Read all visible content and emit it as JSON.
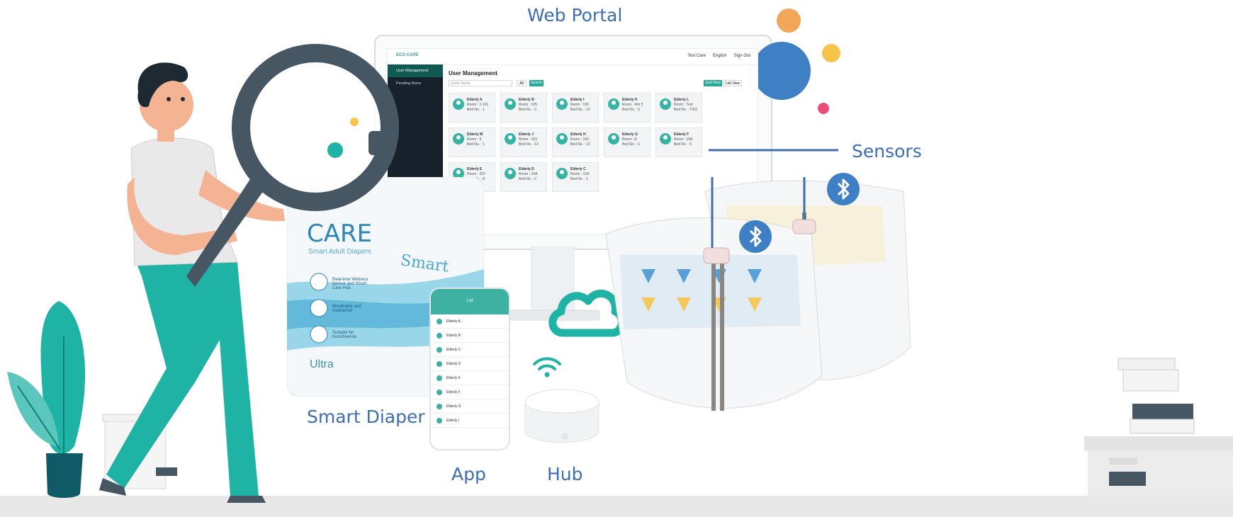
{
  "labels": {
    "web_portal": "Web Portal",
    "sensors": "Sensors",
    "smart_diaper": "Smart Diaper",
    "app": "App",
    "hub": "Hub"
  },
  "portal": {
    "brand": "ECO CARE",
    "top_user": "Test Care",
    "top_lang": "English",
    "top_signout": "Sign Out",
    "sidebar": [
      "User Management",
      "Pending Items"
    ],
    "title": "User Management",
    "search_placeholder": "Enter Name",
    "all_label": "All",
    "search_label": "Search",
    "grid_label": "Grid View",
    "list_label": "List View",
    "cards": [
      {
        "name": "Elderly A",
        "room": "Room : 1-101",
        "bed": "Bed No. : 1"
      },
      {
        "name": "Elderly B",
        "room": "Room : 105",
        "bed": "Bed No. : 2"
      },
      {
        "name": "Elderly I",
        "room": "Room : 100",
        "bed": "Bed No. : 12"
      },
      {
        "name": "Elderly K",
        "room": "Room : Rm 5",
        "bed": "Bed No. : 5"
      },
      {
        "name": "Elderly L",
        "room": "Room : Test",
        "bed": "Bed No. : T001"
      },
      {
        "name": "Elderly M",
        "room": "Room : 9",
        "bed": "Bed No. : 1"
      },
      {
        "name": "Elderly J",
        "room": "Room : 103",
        "bed": "Bed No. : 12"
      },
      {
        "name": "Elderly H",
        "room": "Room : 100",
        "bed": "Bed No. : 12"
      },
      {
        "name": "Elderly G",
        "room": "Room : A",
        "bed": "Bed No. : 1"
      },
      {
        "name": "Elderly F",
        "room": "Room : 10A",
        "bed": "Bed No. : 5"
      },
      {
        "name": "Elderly E",
        "room": "Room : 202",
        "bed": "Bed No. : 8"
      },
      {
        "name": "Elderly D",
        "room": "Room : 10A",
        "bed": "Bed No. : 2"
      },
      {
        "name": "Elderly C",
        "room": "Room : 10A",
        "bed": "Bed No. : 1"
      }
    ]
  },
  "package": {
    "brand": "CARE",
    "subtitle": "Smart Adult Diapers",
    "smart": "Smart",
    "ultra": "Ultra",
    "features": [
      "Real-time Wetness Sensor and Smart Care Hub",
      "Breathable and waterproof",
      "Suitable for Incontinence"
    ]
  },
  "phone": {
    "header": "List",
    "items": [
      "Elderly A",
      "Elderly B",
      "Elderly C",
      "Elderly D",
      "Elderly E",
      "Elderly F",
      "Elderly G",
      "Elderly I"
    ]
  },
  "colors": {
    "label_blue": "#3d6fb0",
    "teal": "#1fb3a5",
    "bluetooth": "#3f7fc4",
    "dark_slate": "#465663"
  },
  "icons": [
    "bluetooth-icon",
    "cloud-icon",
    "wifi-icon",
    "magnifier-icon"
  ]
}
